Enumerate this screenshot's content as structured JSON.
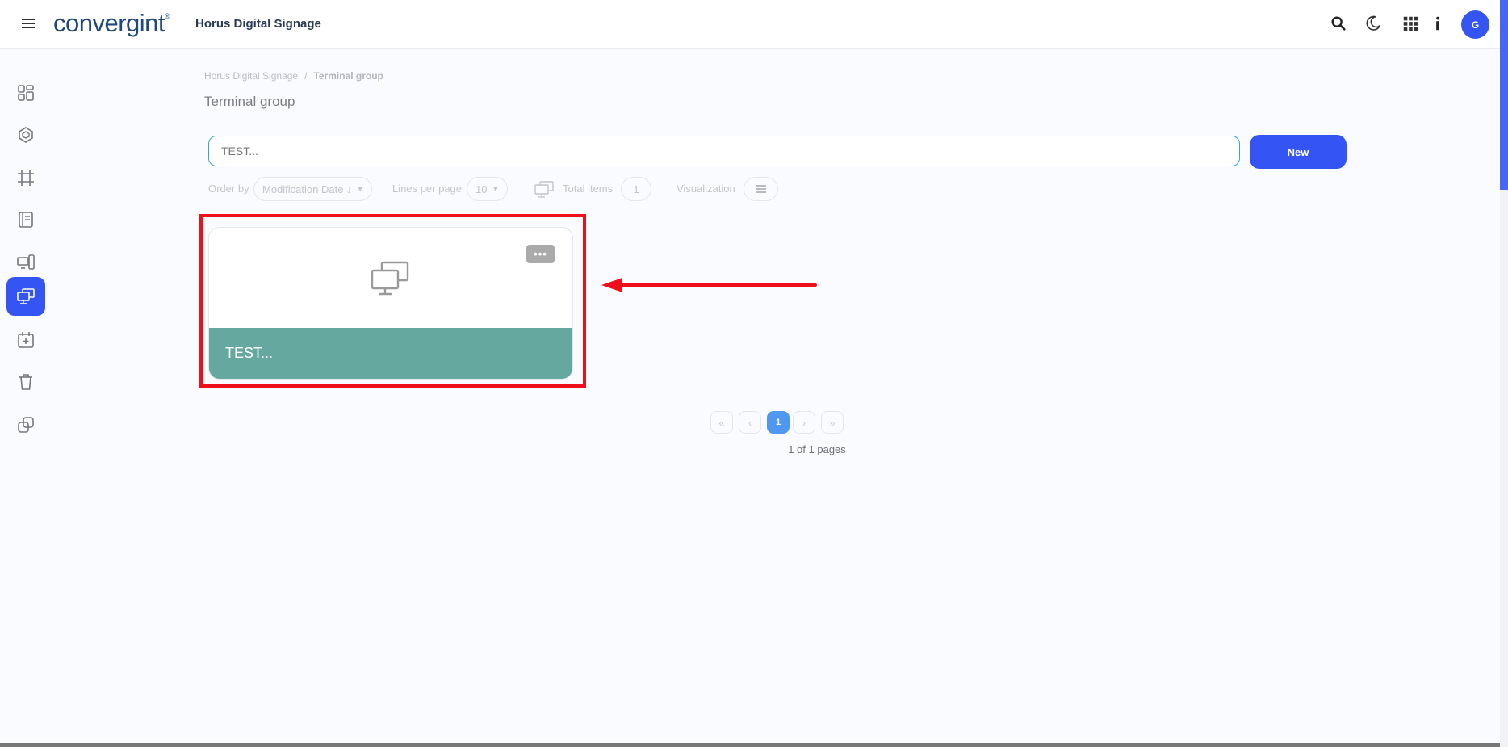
{
  "header": {
    "logo_text": "convergint",
    "logo_mark": "®",
    "app_title": "Horus Digital Signage",
    "avatar_initial": "G",
    "icons": [
      "menu-icon",
      "search-icon",
      "moon-icon",
      "apps-grid-icon",
      "info-icon"
    ]
  },
  "sidebar": {
    "items": [
      {
        "icon": "dashboard-icon",
        "active": false
      },
      {
        "icon": "cube-icon",
        "active": false
      },
      {
        "icon": "frame-icon",
        "active": false
      },
      {
        "icon": "playlist-icon",
        "active": false
      },
      {
        "icon": "devices-icon",
        "active": false
      },
      {
        "icon": "terminal-group-icon",
        "active": true
      },
      {
        "icon": "calendar-add-icon",
        "active": false
      },
      {
        "icon": "trash-icon",
        "active": false
      },
      {
        "icon": "copy-icon",
        "active": false
      }
    ],
    "active_color": "#3454f4"
  },
  "breadcrumb": {
    "root": "Horus Digital Signage",
    "separator": "/",
    "current": "Terminal group"
  },
  "page_title": "Terminal group",
  "search": {
    "value": "TEST..."
  },
  "new_button_label": "New",
  "toolbar": {
    "order_by_label": "Order by",
    "order_by_value": "Modification Date ↓",
    "lines_per_page_label": "Lines per page",
    "lines_per_page_value": "10",
    "total_items_label": "Total items",
    "total_items_value": "1",
    "visualization_label": "Visualization"
  },
  "cards": [
    {
      "title": "TEST...",
      "menu_label": "•••",
      "footer_color": "#64a8a0"
    }
  ],
  "pagination": {
    "first": "«",
    "prev": "‹",
    "current": "1",
    "next": "›",
    "last": "»",
    "summary": "1 of 1 pages"
  },
  "annotation": {
    "highlight_color": "#ee0f1a"
  }
}
